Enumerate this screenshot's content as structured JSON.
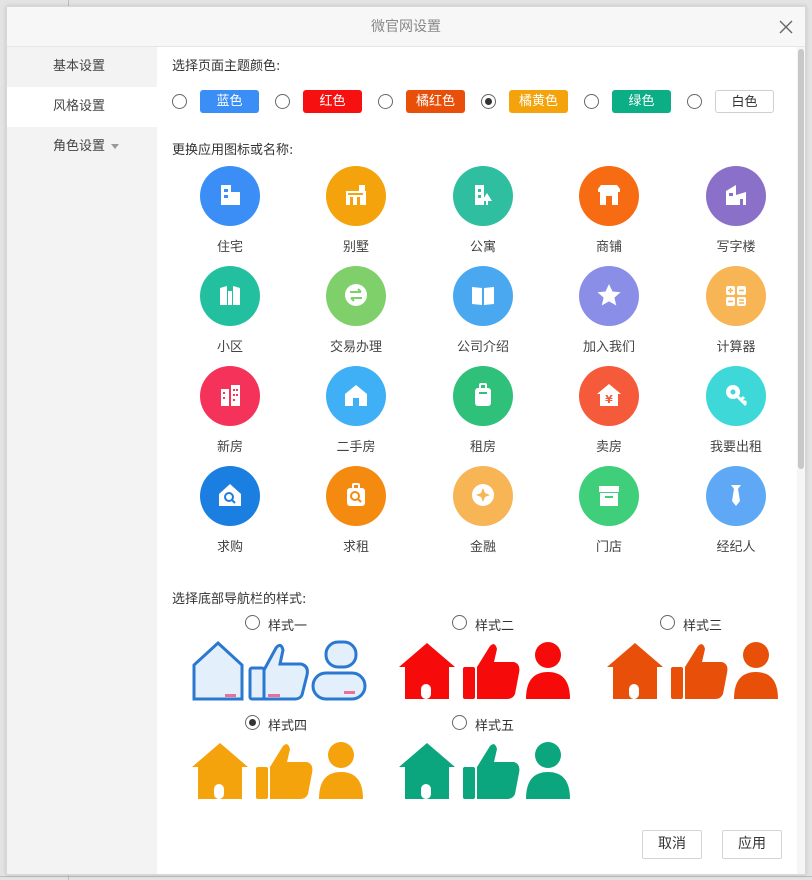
{
  "dialog": {
    "title": "微官网设置",
    "cancel_label": "取消",
    "apply_label": "应用"
  },
  "sidebar": {
    "items": [
      {
        "label": "基本设置"
      },
      {
        "label": "风格设置"
      },
      {
        "label": "角色设置"
      }
    ]
  },
  "theme": {
    "heading": "选择页面主题颜色:",
    "options": [
      {
        "label": "蓝色",
        "color": "#3a8ef6",
        "selected": false
      },
      {
        "label": "红色",
        "color": "#f71010",
        "selected": false
      },
      {
        "label": "橘红色",
        "color": "#e8500a",
        "selected": false
      },
      {
        "label": "橘黄色",
        "color": "#f5a30c",
        "selected": true
      },
      {
        "label": "绿色",
        "color": "#0bae85",
        "selected": false
      },
      {
        "label": "白色",
        "color": "#ffffff",
        "selected": false
      }
    ]
  },
  "icons": {
    "heading": "更换应用图标或名称:",
    "items": [
      {
        "label": "住宅",
        "icon": "building-icon",
        "color": "#3a8ef6"
      },
      {
        "label": "别墅",
        "icon": "villa-icon",
        "color": "#f5a30c"
      },
      {
        "label": "公寓",
        "icon": "apartment-icon",
        "color": "#2fbfa0"
      },
      {
        "label": "商铺",
        "icon": "shop-icon",
        "color": "#f76b12"
      },
      {
        "label": "写字楼",
        "icon": "office-icon",
        "color": "#8a70c8"
      },
      {
        "label": "小区",
        "icon": "community-icon",
        "color": "#23c0a0"
      },
      {
        "label": "交易办理",
        "icon": "exchange-icon",
        "color": "#7fcf6a"
      },
      {
        "label": "公司介绍",
        "icon": "book-icon",
        "color": "#4aa8f0"
      },
      {
        "label": "加入我们",
        "icon": "star-icon",
        "color": "#8a8ee6"
      },
      {
        "label": "计算器",
        "icon": "calculator-icon",
        "color": "#f7b555"
      },
      {
        "label": "新房",
        "icon": "new-house-icon",
        "color": "#f5335a"
      },
      {
        "label": "二手房",
        "icon": "home-icon",
        "color": "#3fb0f5"
      },
      {
        "label": "租房",
        "icon": "luggage-icon",
        "color": "#2fc07a"
      },
      {
        "label": "卖房",
        "icon": "yuan-house-icon",
        "color": "#f55a3a"
      },
      {
        "label": "我要出租",
        "icon": "key-icon",
        "color": "#3fd8d8"
      },
      {
        "label": "求购",
        "icon": "search-house-icon",
        "color": "#1a7fe0"
      },
      {
        "label": "求租",
        "icon": "search-luggage-icon",
        "color": "#f58a10"
      },
      {
        "label": "金融",
        "icon": "finance-icon",
        "color": "#f7b555"
      },
      {
        "label": "门店",
        "icon": "store-icon",
        "color": "#3fcf7a"
      },
      {
        "label": "经纪人",
        "icon": "agent-icon",
        "color": "#5fa8f5"
      }
    ]
  },
  "nav_style": {
    "heading": "选择底部导航栏的样式:",
    "options": [
      {
        "label": "样式一",
        "color": "#2a78d0",
        "selected": false
      },
      {
        "label": "样式二",
        "color": "#f70a0a",
        "selected": false
      },
      {
        "label": "样式三",
        "color": "#e8500a",
        "selected": false
      },
      {
        "label": "样式四",
        "color": "#f5a30c",
        "selected": true
      },
      {
        "label": "样式五",
        "color": "#0ba67e",
        "selected": false
      }
    ]
  }
}
